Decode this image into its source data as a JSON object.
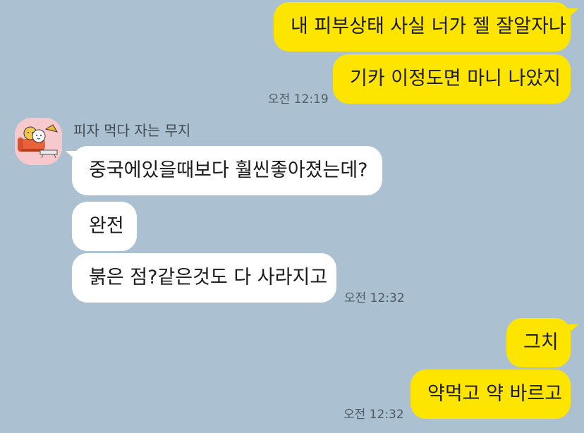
{
  "chat": {
    "group1": {
      "msg1": "내 피부상태 사실 너가 젤 잘알자나",
      "msg2": "기카 이정도면 마니 나았지",
      "time": "오전 12:19"
    },
    "group2": {
      "sender": "피자 먹다 자는 무지",
      "avatar_icon": "sofa-character-icon",
      "msg1": "중국에있을때보다 훨씬좋아졌는데?",
      "msg2": "완전",
      "msg3": "붉은 점?같은것도 다 사라지고",
      "time": "오전 12:32"
    },
    "group3": {
      "msg1": "그치",
      "msg2": "약먹고 약 바르고",
      "time": "오전 12:32"
    }
  },
  "colors": {
    "background": "#abc1d1",
    "my_bubble": "#fee500",
    "their_bubble": "#ffffff",
    "avatar_bg": "#f7c9cc"
  }
}
